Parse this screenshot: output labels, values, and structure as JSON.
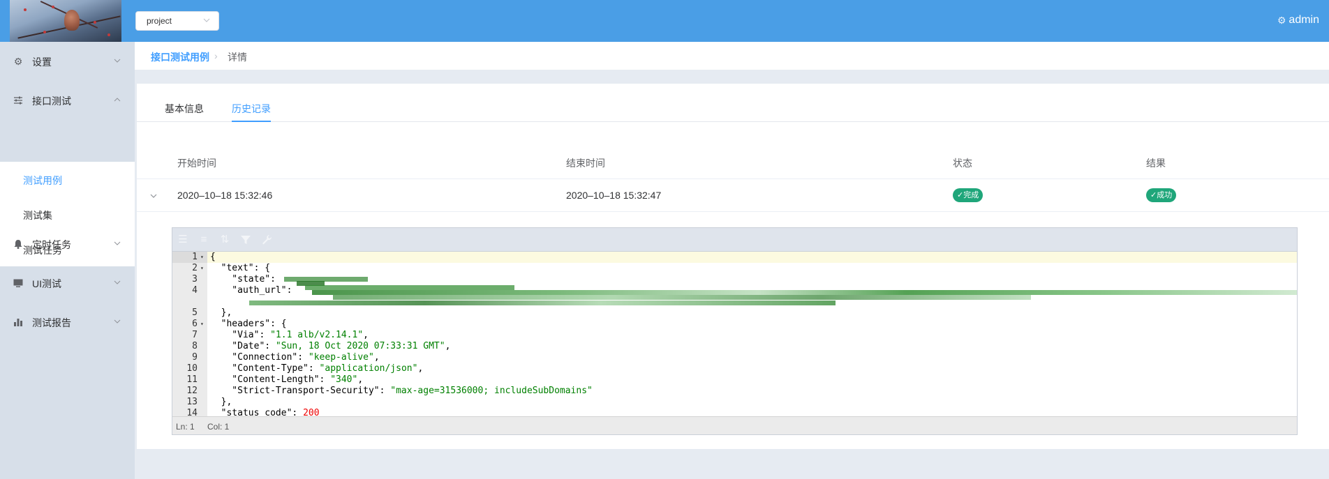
{
  "header": {
    "project_select": "project",
    "user": "admin"
  },
  "sidebar": {
    "items": [
      {
        "label": "设置",
        "icon": "gear-icon"
      },
      {
        "label": "接口测试",
        "icon": "sliders-icon"
      },
      {
        "label": "定时任务",
        "icon": "bell-icon"
      },
      {
        "label": "UI测试",
        "icon": "monitor-icon"
      },
      {
        "label": "测试报告",
        "icon": "bar-chart-icon"
      }
    ],
    "subitems": [
      {
        "label": "测试用例",
        "active": true
      },
      {
        "label": "测试集",
        "active": false
      },
      {
        "label": "测试任务",
        "active": false
      }
    ]
  },
  "breadcrumb": {
    "parent": "接口测试用例",
    "current": "详情"
  },
  "tabs": {
    "basic": "基本信息",
    "history": "历史记录"
  },
  "table": {
    "headers": [
      "开始时间",
      "结束时间",
      "状态",
      "结果"
    ],
    "rows": [
      {
        "start": "2020–10–18 15:32:46",
        "end": "2020–10–18 15:32:47",
        "status": "完成",
        "result": "成功"
      }
    ]
  },
  "editor": {
    "lines": [
      {
        "no": "1",
        "fold": "▾",
        "text": "{"
      },
      {
        "no": "2",
        "fold": "▾",
        "text": "  \"text\": {"
      },
      {
        "no": "3",
        "fold": "",
        "text": "    \"state\": "
      },
      {
        "no": "4",
        "fold": "",
        "text": "    \"auth_url\": "
      },
      {
        "no": "5",
        "fold": "",
        "text": "  },"
      },
      {
        "no": "6",
        "fold": "▾",
        "text": "  \"headers\": {"
      },
      {
        "no": "7",
        "fold": "",
        "key": "    \"Via\": ",
        "val": "\"1.1 alb/v2.14.1\"",
        "tail": ","
      },
      {
        "no": "8",
        "fold": "",
        "key": "    \"Date\": ",
        "val": "\"Sun, 18 Oct 2020 07:33:31 GMT\"",
        "tail": ","
      },
      {
        "no": "9",
        "fold": "",
        "key": "    \"Connection\": ",
        "val": "\"keep-alive\"",
        "tail": ","
      },
      {
        "no": "10",
        "fold": "",
        "key": "    \"Content-Type\": ",
        "val": "\"application/json\"",
        "tail": ","
      },
      {
        "no": "11",
        "fold": "",
        "key": "    \"Content-Length\": ",
        "val": "\"340\"",
        "tail": ","
      },
      {
        "no": "12",
        "fold": "",
        "key": "    \"Strict-Transport-Security\": ",
        "val": "\"max-age=31536000; includeSubDomains\"",
        "tail": ""
      },
      {
        "no": "13",
        "fold": "",
        "text": "  },"
      },
      {
        "no": "14",
        "fold": "",
        "key": "  \"status_code\": ",
        "num": "200",
        "tail": ""
      }
    ],
    "status_ln": "Ln: 1",
    "status_col": "Col: 1"
  },
  "colors": {
    "header": "#4a9ee6",
    "accent": "#409eff",
    "success_tag": "#1fa67a"
  }
}
